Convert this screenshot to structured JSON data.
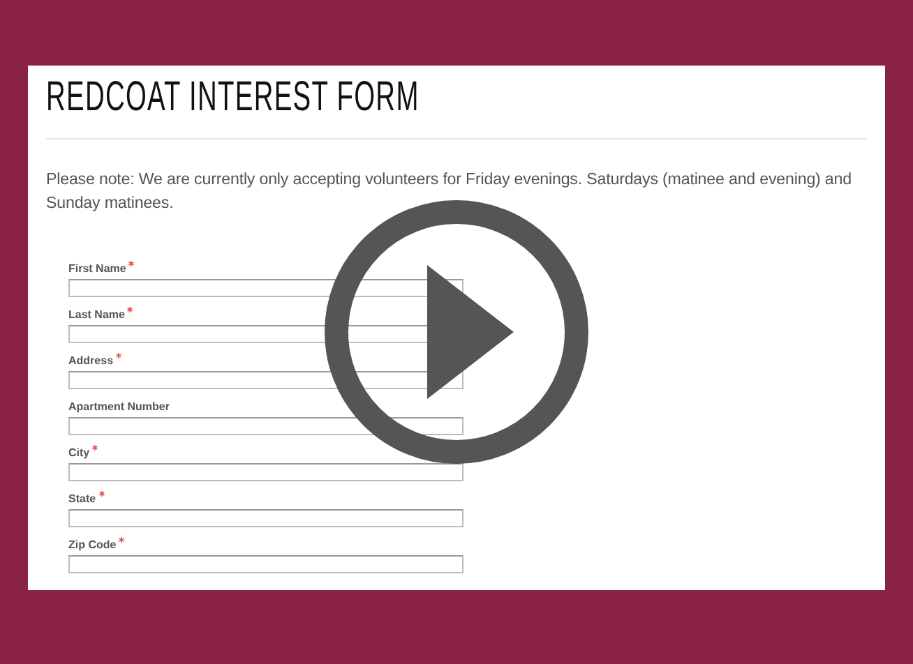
{
  "page": {
    "title": "REDCOAT INTEREST FORM",
    "note": "Please note:  We are currently only accepting volunteers for Friday evenings. Saturdays (matinee and evening) and Sunday matinees."
  },
  "fields": [
    {
      "label": "First Name",
      "required": true
    },
    {
      "label": "Last Name",
      "required": true
    },
    {
      "label": "Address",
      "required": true
    },
    {
      "label": "Apartment Number",
      "required": false
    },
    {
      "label": "City",
      "required": true
    },
    {
      "label": "State",
      "required": true
    },
    {
      "label": "Zip Code",
      "required": true
    }
  ],
  "video": {
    "kind": "play-overlay"
  }
}
